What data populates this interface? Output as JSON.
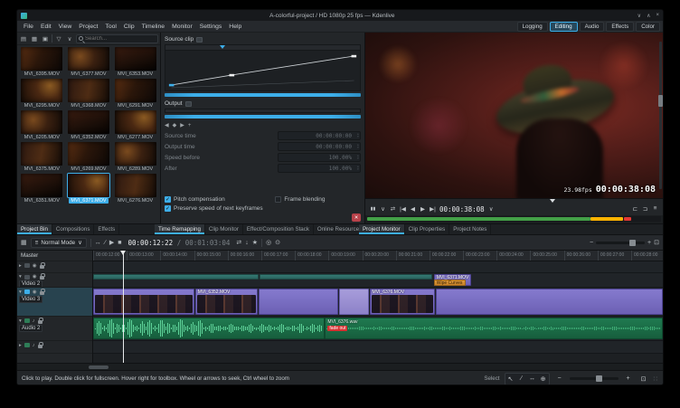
{
  "window": {
    "title": "A-colorful-project / HD 1080p 25 fps — Kdenlive"
  },
  "menu": {
    "items": [
      "File",
      "Edit",
      "View",
      "Project",
      "Tool",
      "Clip",
      "Timeline",
      "Monitor",
      "Settings",
      "Help"
    ]
  },
  "workspaces": {
    "items": [
      "Logging",
      "Editing",
      "Audio",
      "Effects",
      "Color"
    ],
    "active": "Editing"
  },
  "bin": {
    "search_placeholder": "Search...",
    "selected_index": 13,
    "clips": [
      {
        "name": "MVI_6395.MOV"
      },
      {
        "name": "MVI_6377.MOV"
      },
      {
        "name": "MVI_6353.MOV"
      },
      {
        "name": "MVI_6295.MOV"
      },
      {
        "name": "MVI_6368.MOV"
      },
      {
        "name": "MVI_6291.MOV"
      },
      {
        "name": "MVI_6205.MOV"
      },
      {
        "name": "MVI_6352.MOV"
      },
      {
        "name": "MVI_6277.MOV"
      },
      {
        "name": "MVI_6375.MOV"
      },
      {
        "name": "MVI_6269.MOV"
      },
      {
        "name": "MVI_6289.MOV"
      },
      {
        "name": "MVI_6351.MOV"
      },
      {
        "name": "MVI_6371.MOV"
      },
      {
        "name": "MVI_6276.MOV"
      }
    ]
  },
  "remap": {
    "title": "Source clip",
    "output_title": "Output",
    "fields": [
      {
        "label": "Source time",
        "value": "00:00:00:00"
      },
      {
        "label": "Output time",
        "value": "00:00:00:00"
      },
      {
        "label": "Speed before",
        "value": "100.00%"
      },
      {
        "label": "After",
        "value": "100.00%"
      }
    ],
    "checkboxes": [
      {
        "label": "Pitch compensation",
        "checked": true
      },
      {
        "label": "Frame blending",
        "checked": false
      },
      {
        "label": "Preserve speed of next keyframes",
        "checked": true
      }
    ]
  },
  "monitor": {
    "fps_label": "23.98fps",
    "overlay_timecode": "00:00:38:08",
    "timecode": "00:00:38:08"
  },
  "tabs": {
    "left": [
      {
        "label": "Project Bin",
        "active": true
      },
      {
        "label": "Compositions"
      },
      {
        "label": "Effects"
      }
    ],
    "middle": [
      {
        "label": "Time Remapping",
        "active": true
      },
      {
        "label": "Clip Monitor"
      },
      {
        "label": "Effect/Composition Stack"
      },
      {
        "label": "Online Resources"
      }
    ],
    "right": [
      {
        "label": "Project Monitor",
        "active": true
      },
      {
        "label": "Clip Properties"
      },
      {
        "label": "Project Notes"
      }
    ]
  },
  "timeline_toolbar": {
    "mode": "Normal Mode",
    "position": "00:00:12:22",
    "separator": "/",
    "duration": "00:01:03:04"
  },
  "timeline": {
    "master_label": "Master",
    "ruler": [
      "00:00:12:00",
      "00:00:13:00",
      "00:00:14:00",
      "00:00:15:00",
      "00:00:16:00",
      "00:00:17:00",
      "00:00:18:00",
      "00:00:19:00",
      "00:00:20:00",
      "00:00:21:00",
      "00:00:22:00",
      "00:00:23:00",
      "00:00:24:00",
      "00:00:25:00",
      "00:00:26:00",
      "00:00:27:00",
      "00:00:28:00"
    ],
    "tracks": [
      {
        "name": "Video 2"
      },
      {
        "name": "Video 3"
      },
      {
        "name": "Audio 2"
      }
    ],
    "clips": {
      "v2": "MVI_6371.MOV",
      "wipe": "Wipe Curves",
      "v1a": "MVI_6352.MOV",
      "v1b": "MVI_6376.MOV",
      "audio": "MVI_6376.wav",
      "marker": "fade out"
    }
  },
  "statusbar": {
    "hint": "Click to play. Double click for fullscreen. Hover right for toolbox. Wheel or arrows to seek, Ctrl wheel to zoom",
    "select_label": "Select"
  }
}
